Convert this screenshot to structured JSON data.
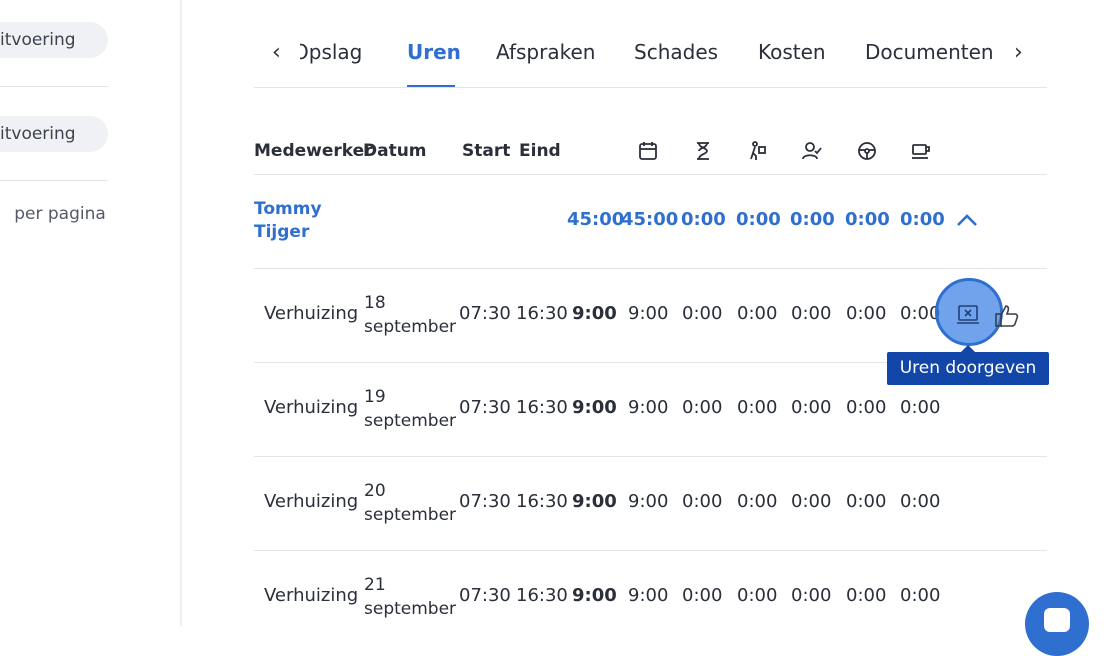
{
  "sidebar": {
    "items": [
      {
        "label": "itvoering"
      },
      {
        "label": "itvoering"
      }
    ],
    "per_page_label": "per pagina"
  },
  "tabs": {
    "items": [
      {
        "label": "Opslag",
        "active": false
      },
      {
        "label": "Uren",
        "active": true
      },
      {
        "label": "Afspraken",
        "active": false
      },
      {
        "label": "Schades",
        "active": false
      },
      {
        "label": "Kosten",
        "active": false
      },
      {
        "label": "Documenten",
        "active": false
      }
    ],
    "prev_icon": "chevron-left-icon",
    "next_icon": "chevron-right-icon"
  },
  "table": {
    "headers": {
      "medewerker": "Medewerker",
      "datum": "Datum",
      "start": "Start",
      "eind": "Eind"
    },
    "header_icons": [
      "calendar-icon",
      "hourglass-icon",
      "travel-icon",
      "user-check-icon",
      "steering-wheel-icon",
      "coffee-cup-icon"
    ],
    "group": {
      "name": "Tommy Tijger",
      "totals": [
        "45:00",
        "45:00",
        "0:00",
        "0:00",
        "0:00",
        "0:00",
        "0:00"
      ],
      "collapse_icon": "chevron-up-icon"
    },
    "rows": [
      {
        "activity": "Verhuizing",
        "day": "18",
        "month": "september",
        "start": "07:30",
        "end": "16:30",
        "total": "9:00",
        "v1": "9:00",
        "v2": "0:00",
        "v3": "0:00",
        "v4": "0:00",
        "v5": "0:00",
        "v6": "0:00"
      },
      {
        "activity": "Verhuizing",
        "day": "19",
        "month": "september",
        "start": "07:30",
        "end": "16:30",
        "total": "9:00",
        "v1": "9:00",
        "v2": "0:00",
        "v3": "0:00",
        "v4": "0:00",
        "v5": "0:00",
        "v6": "0:00"
      },
      {
        "activity": "Verhuizing",
        "day": "20",
        "month": "september",
        "start": "07:30",
        "end": "16:30",
        "total": "9:00",
        "v1": "9:00",
        "v2": "0:00",
        "v3": "0:00",
        "v4": "0:00",
        "v5": "0:00",
        "v6": "0:00"
      },
      {
        "activity": "Verhuizing",
        "day": "21",
        "month": "september",
        "start": "07:30",
        "end": "16:30",
        "total": "9:00",
        "v1": "9:00",
        "v2": "0:00",
        "v3": "0:00",
        "v4": "0:00",
        "v5": "0:00",
        "v6": "0:00"
      }
    ]
  },
  "tooltip": {
    "label": "Uren doorgeven"
  },
  "colors": {
    "accent": "#2f6fd0",
    "tooltip_bg": "#1246a8"
  }
}
